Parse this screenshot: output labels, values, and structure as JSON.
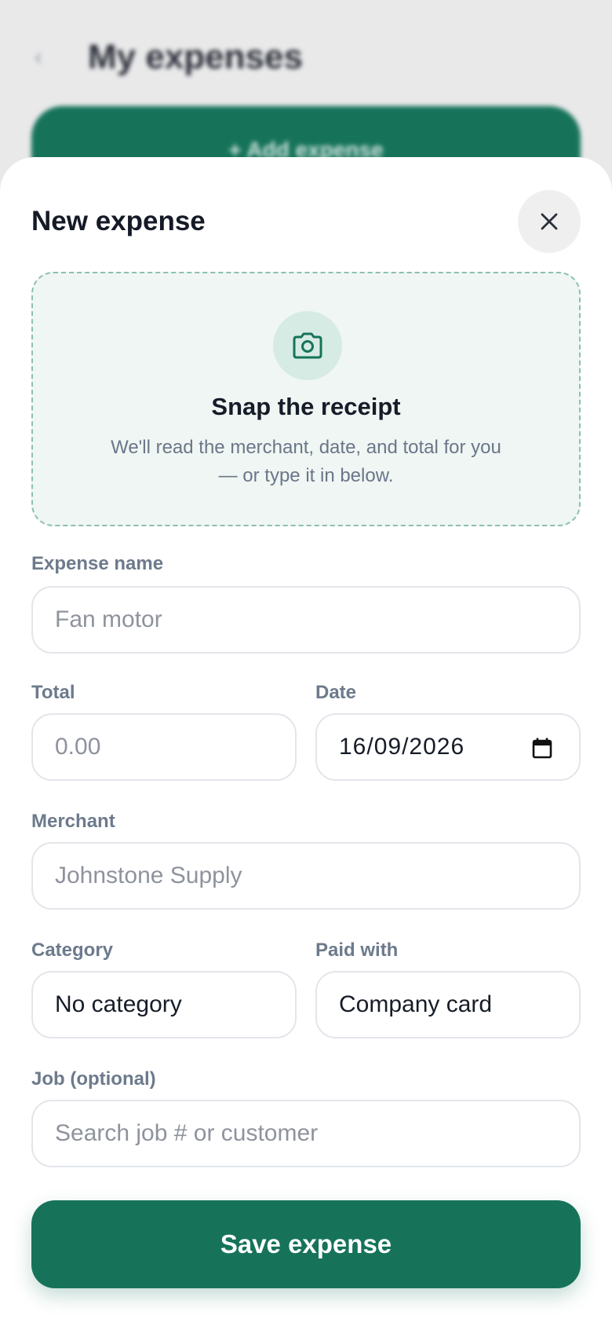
{
  "background": {
    "title": "My expenses",
    "add_button_label": "+ Add expense"
  },
  "sheet": {
    "title": "New expense",
    "close_icon": "close-icon"
  },
  "receipt": {
    "icon": "camera-icon",
    "title": "Snap the receipt",
    "description_line1": "We'll read the merchant, date, and total for you",
    "description_line2": "— or type it in below."
  },
  "form": {
    "expense_name": {
      "label": "Expense name",
      "placeholder": "Fan motor"
    },
    "total": {
      "label": "Total",
      "placeholder": "0.00"
    },
    "date": {
      "label": "Date",
      "value": "16/09/2026"
    },
    "merchant": {
      "label": "Merchant",
      "placeholder": "Johnstone Supply"
    },
    "category": {
      "label": "Category",
      "value": "No category"
    },
    "paid_with": {
      "label": "Paid with",
      "value": "Company card"
    },
    "job": {
      "label": "Job (optional)",
      "placeholder": "Search job # or customer"
    }
  },
  "actions": {
    "save_label": "Save expense"
  },
  "colors": {
    "accent": "#16735a",
    "accent_tint": "#eff6f3",
    "label": "#6d7a8c"
  }
}
